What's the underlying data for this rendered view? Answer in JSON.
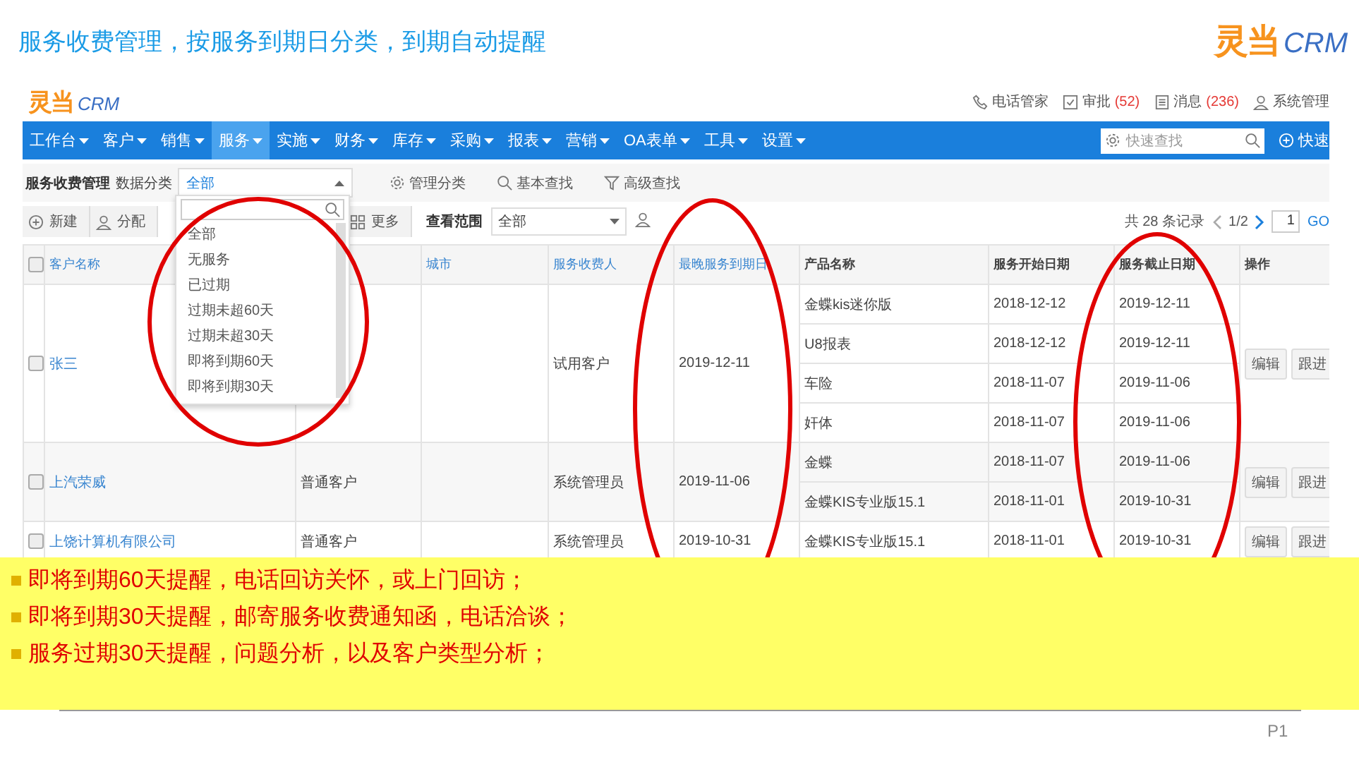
{
  "slide": {
    "title": "服务收费管理，按服务到期日分类，到期自动提醒",
    "logo": {
      "mark": "灵当",
      "text": "CRM"
    },
    "page_number": "P1"
  },
  "app": {
    "logo": {
      "mark": "灵当",
      "text": "CRM"
    },
    "header_links": [
      {
        "kind": "phone",
        "label": "电话管家"
      },
      {
        "kind": "approve",
        "label": "审批",
        "count": "(52)"
      },
      {
        "kind": "message",
        "label": "消息",
        "count": "(236)"
      },
      {
        "kind": "user",
        "label": "系统管理"
      }
    ],
    "nav": [
      {
        "label": "工作台",
        "selected": false
      },
      {
        "label": "客户",
        "selected": false
      },
      {
        "label": "销售",
        "selected": false
      },
      {
        "label": "服务",
        "selected": true
      },
      {
        "label": "实施",
        "selected": false
      },
      {
        "label": "财务",
        "selected": false
      },
      {
        "label": "库存",
        "selected": false
      },
      {
        "label": "采购",
        "selected": false
      },
      {
        "label": "报表",
        "selected": false
      },
      {
        "label": "营销",
        "selected": false
      },
      {
        "label": "OA表单",
        "selected": false
      },
      {
        "label": "工具",
        "selected": false
      },
      {
        "label": "设置",
        "selected": false
      }
    ],
    "quick_search": {
      "placeholder": "快速查找"
    },
    "quick_add": "快速",
    "subbar": {
      "title": "服务收费管理",
      "category_label": "数据分类",
      "category_value": "全部",
      "tools": [
        {
          "kind": "gear",
          "label": "管理分类"
        },
        {
          "kind": "search",
          "label": "基本查找"
        },
        {
          "kind": "filter",
          "label": "高级查找"
        }
      ]
    },
    "dropdown": {
      "options": [
        "全部",
        "无服务",
        "已过期",
        "过期未超60天",
        "过期未超30天",
        "即将到期60天",
        "即将到期30天"
      ]
    },
    "toolbar": {
      "buttons": [
        {
          "kind": "add",
          "label": "新建"
        },
        {
          "kind": "user",
          "label": "分配"
        },
        {
          "kind": "grid",
          "label": "更多"
        }
      ],
      "scope_label": "查看范围",
      "scope_value": "全部",
      "total": "共 28 条记录",
      "page": "1/2",
      "page_input": "1",
      "go": "GO"
    },
    "table": {
      "header_checked": false,
      "columns": [
        {
          "label": "客户名称",
          "sortable": true
        },
        {},
        {
          "label": "城市",
          "sortable": true
        },
        {
          "label": "服务收费人",
          "sortable": true
        },
        {
          "label": "最晚服务到期日",
          "sortable": true
        },
        {
          "label": "产品名称",
          "sortable": false
        },
        {
          "label": "服务开始日期",
          "sortable": false
        },
        {
          "label": "服务截止日期",
          "sortable": false
        },
        {
          "label": "操作",
          "sortable": false
        }
      ],
      "rows": [
        {
          "name": "张三",
          "checked": false,
          "collector": "试用客户",
          "latest_due": "2019-12-11",
          "actions": [
            "编辑",
            "跟进"
          ],
          "products": [
            {
              "name": "金蝶kis迷你版",
              "start": "2018-12-12",
              "end": "2019-12-11"
            },
            {
              "name": "U8报表",
              "start": "2018-12-12",
              "end": "2019-12-11"
            },
            {
              "name": "车险",
              "start": "2018-11-07",
              "end": "2019-11-06"
            },
            {
              "name": "奸体",
              "start": "2018-11-07",
              "end": "2019-11-06"
            }
          ]
        },
        {
          "name": "上汽荣威",
          "checked": false,
          "type": "普通客户",
          "collector": "系统管理员",
          "latest_due": "2019-11-06",
          "actions": [
            "编辑",
            "跟进"
          ],
          "products": [
            {
              "name": "金蝶",
              "start": "2018-11-07",
              "end": "2019-11-06"
            },
            {
              "name": "金蝶KIS专业版15.1",
              "start": "2018-11-01",
              "end": "2019-10-31"
            }
          ]
        },
        {
          "name": "上饶计算机有限公司",
          "checked": false,
          "type": "普通客户",
          "collector": "系统管理员",
          "latest_due": "2019-10-31",
          "actions": [
            "编辑",
            "跟进"
          ],
          "products": [
            {
              "name": "金蝶KIS专业版15.1",
              "start": "2018-11-01",
              "end": "2019-10-31"
            }
          ]
        }
      ]
    }
  },
  "annotations": [
    {
      "kind": "ellipse"
    },
    {
      "kind": "ellipse"
    },
    {
      "kind": "ellipse"
    }
  ],
  "notes": [
    "即将到期60天提醒，电话回访关怀，或上门回访；",
    "即将到期30天提醒，邮寄服务收费通知函，电话洽谈；",
    "服务过期30天提醒，问题分析，以及客户类型分析；"
  ]
}
